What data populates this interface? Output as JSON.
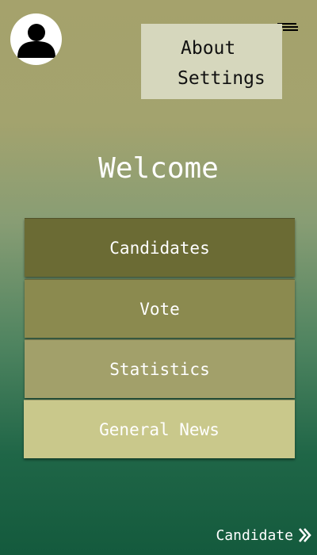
{
  "header": {
    "avatar_icon": "user-profile-icon",
    "menu_icon": "hamburger-menu-icon"
  },
  "dropdown": {
    "items": [
      {
        "label": "About"
      },
      {
        "label": "Settings"
      }
    ]
  },
  "main": {
    "welcome": "Welcome",
    "buttons": [
      {
        "label": "Candidates",
        "color": "#6b6b34"
      },
      {
        "label": "Vote",
        "color": "#8b8a4f"
      },
      {
        "label": "Statistics",
        "color": "#a2a06a"
      },
      {
        "label": "General News",
        "color": "#c9c88b"
      }
    ]
  },
  "footer": {
    "link_label": "Candidate",
    "link_icon": "double-chevron-right-icon"
  }
}
